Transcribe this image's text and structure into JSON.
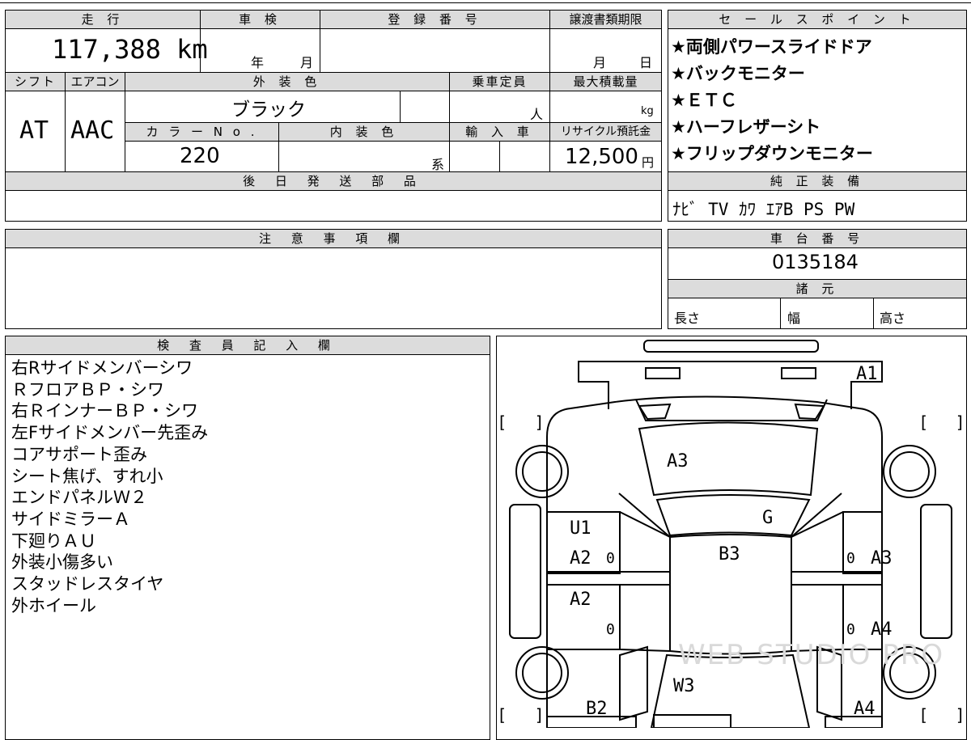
{
  "top_left": {
    "mileage_header": "走 行",
    "mileage": "117,388 km",
    "inspection_header": "車 検",
    "inspection_year": "年",
    "inspection_month": "月",
    "registration_header": "登 録 番 号",
    "transfer_header": "譲渡書類期限",
    "transfer_month": "月",
    "transfer_day": "日",
    "shift_header": "シフト",
    "shift": "AT",
    "aircon_header": "エアコン",
    "aircon": "AAC",
    "exterior_color_header": "外 装 色",
    "exterior_color": "ブラック",
    "capacity_header": "乗車定員",
    "capacity_unit": "人",
    "max_load_header": "最大積載量",
    "max_load_unit": "kg",
    "color_no_header": "カ ラ ー N o .",
    "color_no": "220",
    "interior_color_header": "内 装 色",
    "interior_color_unit": "系",
    "import_header": "輸 入 車",
    "recycle_header": "リサイクル預託金",
    "recycle_fee": "12,500",
    "recycle_unit": "円",
    "later_parts_header": "後 日 発 送 部 品"
  },
  "sales_points": {
    "header": "セ ー ル ス ポ イ ン ト",
    "items": [
      "★両側パワースライドドア",
      "★バックモニター",
      "★ＥＴＣ",
      "★ハーフレザーシト",
      "★フリップダウンモニター"
    ]
  },
  "genuine_equipment": {
    "header": "純 正 装 備",
    "value": "ﾅﾋﾞ TV ｶﾜ ｴｱB PS PW"
  },
  "caution": {
    "header": "注 意 事 項 欄"
  },
  "chassis": {
    "header": "車 台 番 号",
    "number": "0135184"
  },
  "specs": {
    "header": "諸 元",
    "length": "長さ",
    "width": "幅",
    "height": "高さ"
  },
  "inspector": {
    "header": "検 査 員 記 入 欄",
    "notes": [
      {
        "text": "右Rサイドメンバーシワ",
        "underline": true
      },
      {
        "text": "ＲフロアＢＰ・シワ",
        "underline": true
      },
      {
        "text": "右ＲインナーＢＰ・シワ",
        "underline": true
      },
      {
        "text": "左Fサイドメンバー先歪み",
        "underline": true
      },
      {
        "text": "コアサポート歪み",
        "underline": true
      },
      {
        "text": "シート焦げ、すれ小",
        "underline": false
      },
      {
        "text": "エンドパネルＷ２",
        "underline": false
      },
      {
        "text": "サイドミラーＡ",
        "underline": false
      },
      {
        "text": "下廻りＡＵ",
        "underline": false
      },
      {
        "text": "外装小傷多い",
        "underline": false
      },
      {
        "text": "スタッドレスタイヤ",
        "underline": false
      },
      {
        "text": "外ホイール",
        "underline": false
      }
    ]
  },
  "diagram": {
    "labels": {
      "a1": "A1",
      "a3_hood": "A3",
      "g": "G",
      "u1": "U1",
      "a2_front_left": "A2",
      "b3": "B3",
      "a3_right": "A3",
      "a2_rear_left": "A2",
      "a4_right": "A4",
      "w3": "W3",
      "b2": "B2",
      "a4_rear_right": "A4",
      "zero1": "0",
      "zero2": "0",
      "zero3": "0",
      "zero4": "0"
    },
    "watermark": "WEB STUDIO PRO",
    "bracket_open": "[",
    "bracket_close": "]"
  }
}
